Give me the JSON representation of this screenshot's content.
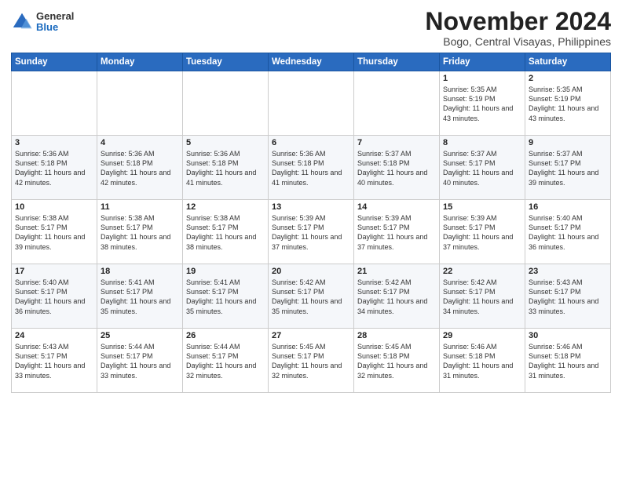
{
  "logo": {
    "general": "General",
    "blue": "Blue"
  },
  "title": "November 2024",
  "location": "Bogo, Central Visayas, Philippines",
  "days_of_week": [
    "Sunday",
    "Monday",
    "Tuesday",
    "Wednesday",
    "Thursday",
    "Friday",
    "Saturday"
  ],
  "weeks": [
    [
      {
        "day": "",
        "info": ""
      },
      {
        "day": "",
        "info": ""
      },
      {
        "day": "",
        "info": ""
      },
      {
        "day": "",
        "info": ""
      },
      {
        "day": "",
        "info": ""
      },
      {
        "day": "1",
        "info": "Sunrise: 5:35 AM\nSunset: 5:19 PM\nDaylight: 11 hours\nand 43 minutes."
      },
      {
        "day": "2",
        "info": "Sunrise: 5:35 AM\nSunset: 5:19 PM\nDaylight: 11 hours\nand 43 minutes."
      }
    ],
    [
      {
        "day": "3",
        "info": "Sunrise: 5:36 AM\nSunset: 5:18 PM\nDaylight: 11 hours\nand 42 minutes."
      },
      {
        "day": "4",
        "info": "Sunrise: 5:36 AM\nSunset: 5:18 PM\nDaylight: 11 hours\nand 42 minutes."
      },
      {
        "day": "5",
        "info": "Sunrise: 5:36 AM\nSunset: 5:18 PM\nDaylight: 11 hours\nand 41 minutes."
      },
      {
        "day": "6",
        "info": "Sunrise: 5:36 AM\nSunset: 5:18 PM\nDaylight: 11 hours\nand 41 minutes."
      },
      {
        "day": "7",
        "info": "Sunrise: 5:37 AM\nSunset: 5:18 PM\nDaylight: 11 hours\nand 40 minutes."
      },
      {
        "day": "8",
        "info": "Sunrise: 5:37 AM\nSunset: 5:17 PM\nDaylight: 11 hours\nand 40 minutes."
      },
      {
        "day": "9",
        "info": "Sunrise: 5:37 AM\nSunset: 5:17 PM\nDaylight: 11 hours\nand 39 minutes."
      }
    ],
    [
      {
        "day": "10",
        "info": "Sunrise: 5:38 AM\nSunset: 5:17 PM\nDaylight: 11 hours\nand 39 minutes."
      },
      {
        "day": "11",
        "info": "Sunrise: 5:38 AM\nSunset: 5:17 PM\nDaylight: 11 hours\nand 38 minutes."
      },
      {
        "day": "12",
        "info": "Sunrise: 5:38 AM\nSunset: 5:17 PM\nDaylight: 11 hours\nand 38 minutes."
      },
      {
        "day": "13",
        "info": "Sunrise: 5:39 AM\nSunset: 5:17 PM\nDaylight: 11 hours\nand 37 minutes."
      },
      {
        "day": "14",
        "info": "Sunrise: 5:39 AM\nSunset: 5:17 PM\nDaylight: 11 hours\nand 37 minutes."
      },
      {
        "day": "15",
        "info": "Sunrise: 5:39 AM\nSunset: 5:17 PM\nDaylight: 11 hours\nand 37 minutes."
      },
      {
        "day": "16",
        "info": "Sunrise: 5:40 AM\nSunset: 5:17 PM\nDaylight: 11 hours\nand 36 minutes."
      }
    ],
    [
      {
        "day": "17",
        "info": "Sunrise: 5:40 AM\nSunset: 5:17 PM\nDaylight: 11 hours\nand 36 minutes."
      },
      {
        "day": "18",
        "info": "Sunrise: 5:41 AM\nSunset: 5:17 PM\nDaylight: 11 hours\nand 35 minutes."
      },
      {
        "day": "19",
        "info": "Sunrise: 5:41 AM\nSunset: 5:17 PM\nDaylight: 11 hours\nand 35 minutes."
      },
      {
        "day": "20",
        "info": "Sunrise: 5:42 AM\nSunset: 5:17 PM\nDaylight: 11 hours\nand 35 minutes."
      },
      {
        "day": "21",
        "info": "Sunrise: 5:42 AM\nSunset: 5:17 PM\nDaylight: 11 hours\nand 34 minutes."
      },
      {
        "day": "22",
        "info": "Sunrise: 5:42 AM\nSunset: 5:17 PM\nDaylight: 11 hours\nand 34 minutes."
      },
      {
        "day": "23",
        "info": "Sunrise: 5:43 AM\nSunset: 5:17 PM\nDaylight: 11 hours\nand 33 minutes."
      }
    ],
    [
      {
        "day": "24",
        "info": "Sunrise: 5:43 AM\nSunset: 5:17 PM\nDaylight: 11 hours\nand 33 minutes."
      },
      {
        "day": "25",
        "info": "Sunrise: 5:44 AM\nSunset: 5:17 PM\nDaylight: 11 hours\nand 33 minutes."
      },
      {
        "day": "26",
        "info": "Sunrise: 5:44 AM\nSunset: 5:17 PM\nDaylight: 11 hours\nand 32 minutes."
      },
      {
        "day": "27",
        "info": "Sunrise: 5:45 AM\nSunset: 5:17 PM\nDaylight: 11 hours\nand 32 minutes."
      },
      {
        "day": "28",
        "info": "Sunrise: 5:45 AM\nSunset: 5:18 PM\nDaylight: 11 hours\nand 32 minutes."
      },
      {
        "day": "29",
        "info": "Sunrise: 5:46 AM\nSunset: 5:18 PM\nDaylight: 11 hours\nand 31 minutes."
      },
      {
        "day": "30",
        "info": "Sunrise: 5:46 AM\nSunset: 5:18 PM\nDaylight: 11 hours\nand 31 minutes."
      }
    ]
  ]
}
